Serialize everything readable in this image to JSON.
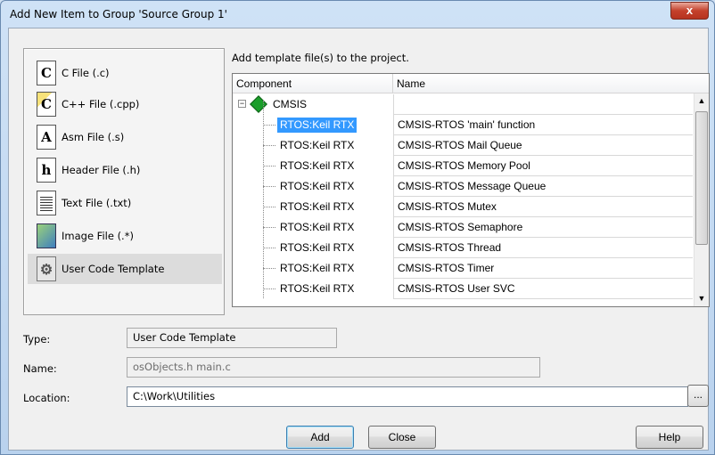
{
  "window": {
    "title": "Add New Item to Group 'Source Group 1'",
    "close_label": "x"
  },
  "file_types": [
    {
      "label": "C File (.c)",
      "icon": "c-file-icon",
      "glyph": "C"
    },
    {
      "label": "C++ File (.cpp)",
      "icon": "cpp-file-icon",
      "glyph": "C"
    },
    {
      "label": "Asm File (.s)",
      "icon": "asm-file-icon",
      "glyph": "A"
    },
    {
      "label": "Header File (.h)",
      "icon": "header-file-icon",
      "glyph": "h"
    },
    {
      "label": "Text File (.txt)",
      "icon": "text-file-icon",
      "glyph": ""
    },
    {
      "label": "Image File (.*)",
      "icon": "image-file-icon",
      "glyph": ""
    },
    {
      "label": "User Code Template",
      "icon": "user-code-template-icon",
      "glyph": "⚙",
      "selected": true
    }
  ],
  "template_panel": {
    "heading": "Add template file(s) to the project.",
    "columns": {
      "component": "Component",
      "name": "Name"
    },
    "root": "CMSIS",
    "rows": [
      {
        "component": "RTOS:Keil RTX",
        "name": "CMSIS-RTOS 'main' function",
        "selected": true
      },
      {
        "component": "RTOS:Keil RTX",
        "name": "CMSIS-RTOS Mail Queue"
      },
      {
        "component": "RTOS:Keil RTX",
        "name": "CMSIS-RTOS Memory Pool"
      },
      {
        "component": "RTOS:Keil RTX",
        "name": "CMSIS-RTOS Message Queue"
      },
      {
        "component": "RTOS:Keil RTX",
        "name": "CMSIS-RTOS Mutex"
      },
      {
        "component": "RTOS:Keil RTX",
        "name": "CMSIS-RTOS Semaphore"
      },
      {
        "component": "RTOS:Keil RTX",
        "name": "CMSIS-RTOS Thread"
      },
      {
        "component": "RTOS:Keil RTX",
        "name": "CMSIS-RTOS Timer"
      },
      {
        "component": "RTOS:Keil RTX",
        "name": "CMSIS-RTOS User SVC"
      }
    ]
  },
  "fields": {
    "type_label": "Type:",
    "type_value": "User Code Template",
    "name_label": "Name:",
    "name_value": "osObjects.h main.c",
    "location_label": "Location:",
    "location_value": "C:\\Work\\Utilities",
    "browse_label": "..."
  },
  "buttons": {
    "add": "Add",
    "close": "Close",
    "help": "Help"
  },
  "colors": {
    "selection": "#3399ff",
    "title_bar": "#c5dbf2"
  }
}
